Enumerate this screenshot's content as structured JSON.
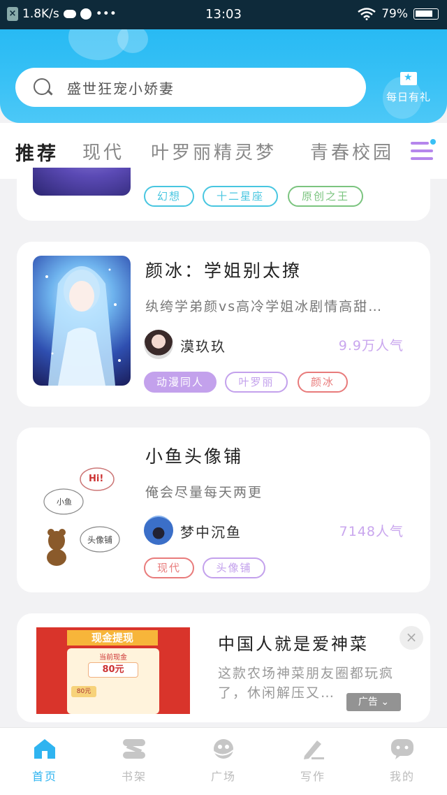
{
  "status_bar": {
    "speed": "1.8K/s",
    "dots": "•••",
    "time": "13:03",
    "battery": "79%"
  },
  "header": {
    "search_text": "盛世狂宠小娇妻",
    "daily_label": "每日有礼",
    "colors": {
      "accent": "#36c0f5",
      "purple": "#c3a1ec"
    }
  },
  "tabs": [
    {
      "label": "推荐"
    },
    {
      "label": "现代"
    },
    {
      "label": "叶罗丽精灵梦"
    },
    {
      "label": "青春校园"
    }
  ],
  "cards": [
    {
      "tags": [
        {
          "label": "幻想",
          "color": "#48c6e0"
        },
        {
          "label": "十二星座",
          "color": "#48c6e0"
        },
        {
          "label": "原创之王",
          "color": "#7bc47f"
        }
      ]
    },
    {
      "title": "颜冰：学姐别太撩",
      "desc": "纨绔学弟颜vs高冷学姐冰剧情高甜…",
      "author": "漠玖玖",
      "popularity": "9.9万人气",
      "tags": [
        {
          "label": "动漫同人",
          "color": "#c3a1ec",
          "filled": true
        },
        {
          "label": "叶罗丽",
          "color": "#c3a1ec"
        },
        {
          "label": "颜冰",
          "color": "#e87b7b"
        }
      ]
    },
    {
      "title": "小鱼头像铺",
      "desc": "俺会尽量每天两更",
      "author": "梦中沉鱼",
      "popularity": "7148人气",
      "cover_texts": {
        "hi": "Hi!",
        "fish": "小鱼",
        "shop": "头像铺"
      },
      "tags": [
        {
          "label": "现代",
          "color": "#e87b7b"
        },
        {
          "label": "头像铺",
          "color": "#c3a1ec"
        }
      ]
    }
  ],
  "ad": {
    "title": "中国人就是爱神菜",
    "desc": "这款农场神菜朋友圈都玩疯了，休闲解压又…",
    "badge": "广告",
    "close": "×",
    "image_texts": {
      "banner": "现金提现",
      "amount": "80元",
      "current": "当前现金",
      "small": "80元"
    }
  },
  "bottom_nav": [
    {
      "label": "首页",
      "active": true,
      "icon": "home-icon"
    },
    {
      "label": "书架",
      "active": false,
      "icon": "bookshelf-icon"
    },
    {
      "label": "广场",
      "active": false,
      "icon": "square-icon"
    },
    {
      "label": "写作",
      "active": false,
      "icon": "write-icon"
    },
    {
      "label": "我的",
      "active": false,
      "icon": "profile-icon"
    }
  ]
}
